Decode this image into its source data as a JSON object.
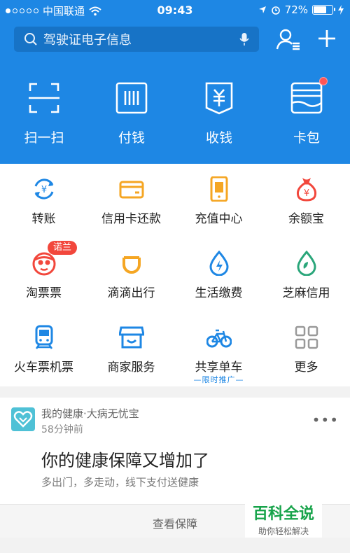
{
  "status_bar": {
    "carrier": "中国联通",
    "time": "09:43",
    "battery": "72%",
    "battery_level": 0.72
  },
  "search": {
    "placeholder": "驾驶证电子信息"
  },
  "quick_actions": [
    {
      "label": "扫一扫",
      "icon": "scan-icon"
    },
    {
      "label": "付钱",
      "icon": "barcode-pay-icon"
    },
    {
      "label": "收钱",
      "icon": "receive-money-icon"
    },
    {
      "label": "卡包",
      "icon": "card-wallet-icon"
    }
  ],
  "grid": {
    "items": [
      {
        "label": "转账",
        "icon": "transfer-icon"
      },
      {
        "label": "信用卡还款",
        "icon": "credit-card-icon"
      },
      {
        "label": "充值中心",
        "icon": "phone-recharge-icon"
      },
      {
        "label": "余额宝",
        "icon": "money-bag-icon"
      },
      {
        "label": "淘票票",
        "icon": "taopiaopiao-icon"
      },
      {
        "label": "滴滴出行",
        "icon": "didi-icon"
      },
      {
        "label": "生活缴费",
        "icon": "utility-drop-icon"
      },
      {
        "label": "芝麻信用",
        "icon": "sesame-credit-icon"
      },
      {
        "label": "火车票机票",
        "icon": "train-icon"
      },
      {
        "label": "商家服务",
        "icon": "shop-icon"
      },
      {
        "label": "共享单车",
        "icon": "bicycle-icon"
      },
      {
        "label": "更多",
        "icon": "more-grid-icon"
      }
    ],
    "badge": "诺兰",
    "sub_label": "—限时推广—"
  },
  "card": {
    "source": "我的健康·大病无忧宝",
    "ago": "58分钟前",
    "title": "你的健康保障又增加了",
    "desc": "多出门，多走动，线下支付送健康"
  },
  "view_button": "查看保障",
  "watermark": {
    "line1": "百科全说",
    "line2": "助你轻松解决"
  },
  "colors": {
    "brand_blue": "#1e87e4",
    "accent_red": "#f2473c",
    "orange": "#f5a623"
  }
}
